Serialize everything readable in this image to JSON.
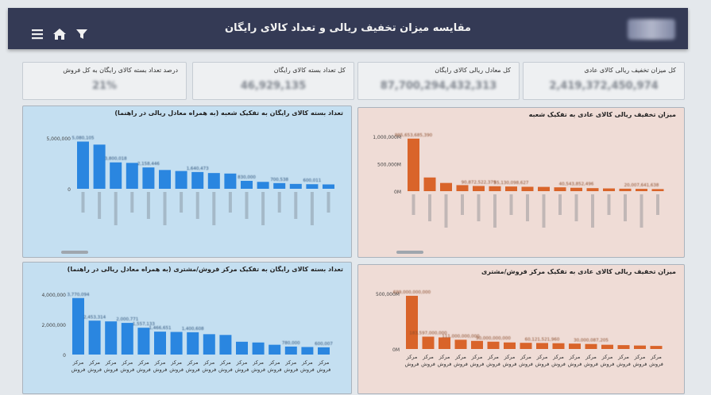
{
  "header": {
    "title": "مقایسه میزان تخفیف ریالی و تعداد کالای رایگان",
    "logo_label": "خانه شاکر"
  },
  "toolbar": {
    "menu_icon": "menu-icon",
    "home_icon": "home-icon",
    "filter_icon": "filter-icon"
  },
  "kpis": [
    {
      "label": "کل میزان تخفیف ریالی کالای عادی",
      "value": "2,419,372,450,974"
    },
    {
      "label": "کل معادل ریالی کالای رایگان",
      "value": "87,700,294,432,313"
    },
    {
      "label": "کل تعداد بسته کالای رایگان",
      "value": "46,929,135"
    },
    {
      "label": "درصد تعداد بسته کالای رایگان به کل فروش",
      "value": "21%"
    }
  ],
  "colors": {
    "blue_bar": "#2a86e0",
    "orange_bar": "#d9642a",
    "blue_panel": "#c4dff1",
    "peach_panel": "#efdcd6",
    "header": "#343a55"
  },
  "chart_data": [
    {
      "id": "free-by-branch",
      "type": "bar",
      "title": "تعداد بسته کالای رایگان به تفکیک شعبه (به همراه معادل ریالی در راهنما)",
      "yticks": [
        "5,000,000",
        "0"
      ],
      "ylim": [
        0,
        5000000
      ],
      "values": [
        4650000,
        4350000,
        2600000,
        2550000,
        2100000,
        1850000,
        1750000,
        1650000,
        1550000,
        1500000,
        780000,
        680000,
        560000,
        480000,
        450000,
        430000
      ],
      "data_labels": [
        "5,080,105",
        "",
        "3,800,018",
        "",
        "2,158,446",
        "",
        "",
        "1,640,473",
        "",
        "",
        "830,000",
        "",
        "700,538",
        "",
        "600,011",
        ""
      ],
      "categories": [
        "",
        "",
        "",
        "",
        "",
        "",
        "",
        "",
        "",
        "",
        "",
        "",
        "",
        "",
        "",
        ""
      ]
    },
    {
      "id": "discount-by-branch",
      "type": "bar",
      "title": "میزان تخفیف ریالی کالای عادی به تفکیک شعبه",
      "yticks": [
        "1,000,000M",
        "500,000M",
        "0M"
      ],
      "ylim": [
        0,
        1000000
      ],
      "values": [
        960000,
        250000,
        150000,
        110000,
        95000,
        90000,
        85000,
        80000,
        78000,
        70000,
        62000,
        55000,
        50000,
        45000,
        42000,
        38000
      ],
      "data_labels": [
        "995,653,685,390",
        "",
        "",
        "",
        "90,872,522,379",
        "",
        "55,130,098,627",
        "",
        "",
        "",
        "40,543,852,496",
        "",
        "",
        "",
        "20,007,641,638",
        ""
      ],
      "categories": [
        "",
        "",
        "",
        "",
        "",
        "",
        "",
        "",
        "",
        "",
        "",
        "",
        "",
        "",
        "",
        ""
      ]
    },
    {
      "id": "free-by-center",
      "type": "bar",
      "title": "تعداد بسته کالای رایگان به تفکیک مرکز فروش/مشتری (به همراه معادل ریالی در راهنما)",
      "yticks": [
        "4,000,000",
        "2,000,000",
        "0"
      ],
      "ylim": [
        0,
        4000000
      ],
      "values": [
        3750000,
        2250000,
        2200000,
        2100000,
        1780000,
        1520000,
        1500000,
        1480000,
        1350000,
        1300000,
        850000,
        800000,
        650000,
        530000,
        500000,
        480000
      ],
      "data_labels": [
        "3,770,094",
        "2,453,314",
        "",
        "2,000,771",
        "1,557,133",
        "1,466,651",
        "",
        "1,400,608",
        "",
        "",
        "",
        "",
        "",
        "780,000",
        "",
        "600,007"
      ],
      "categories": [
        "مرکز فروش",
        "مرکز فروش",
        "مرکز فروش",
        "مرکز فروش",
        "مرکز فروش",
        "مرکز فروش",
        "مرکز فروش",
        "مرکز فروش",
        "مرکز فروش",
        "مرکز فروش",
        "مرکز فروش",
        "مرکز فروش",
        "مرکز فروش",
        "مرکز فروش",
        "مرکز فروش",
        "مرکز فروش"
      ]
    },
    {
      "id": "discount-by-center",
      "type": "bar",
      "title": "میزان تخفیف ریالی کالای عادی به تفکیک مرکز فروش/مشتری",
      "yticks": [
        "500,000M",
        "0M"
      ],
      "ylim": [
        0,
        720000
      ],
      "values": [
        690000,
        160000,
        150000,
        120000,
        105000,
        95000,
        85000,
        80000,
        78000,
        75000,
        70000,
        65000,
        55000,
        50000,
        45000,
        40000
      ],
      "data_labels": [
        "699,000,000,000",
        "183,597,000,000",
        "",
        "111,000,000,000",
        "",
        "90,000,000,000",
        "",
        "",
        "60,121,521,960",
        "",
        "",
        "30,000,087,205",
        "",
        "",
        "",
        ""
      ],
      "categories": [
        "مرکز فروش",
        "مرکز فروش",
        "مرکز فروش",
        "مرکز فروش",
        "مرکز فروش",
        "مرکز فروش",
        "مرکز فروش",
        "مرکز فروش",
        "مرکز فروش",
        "مرکز فروش",
        "مرکز فروش",
        "مرکز فروش",
        "مرکز فروش",
        "مرکز فروش",
        "مرکز فروش",
        "مرکز فروش"
      ]
    }
  ]
}
